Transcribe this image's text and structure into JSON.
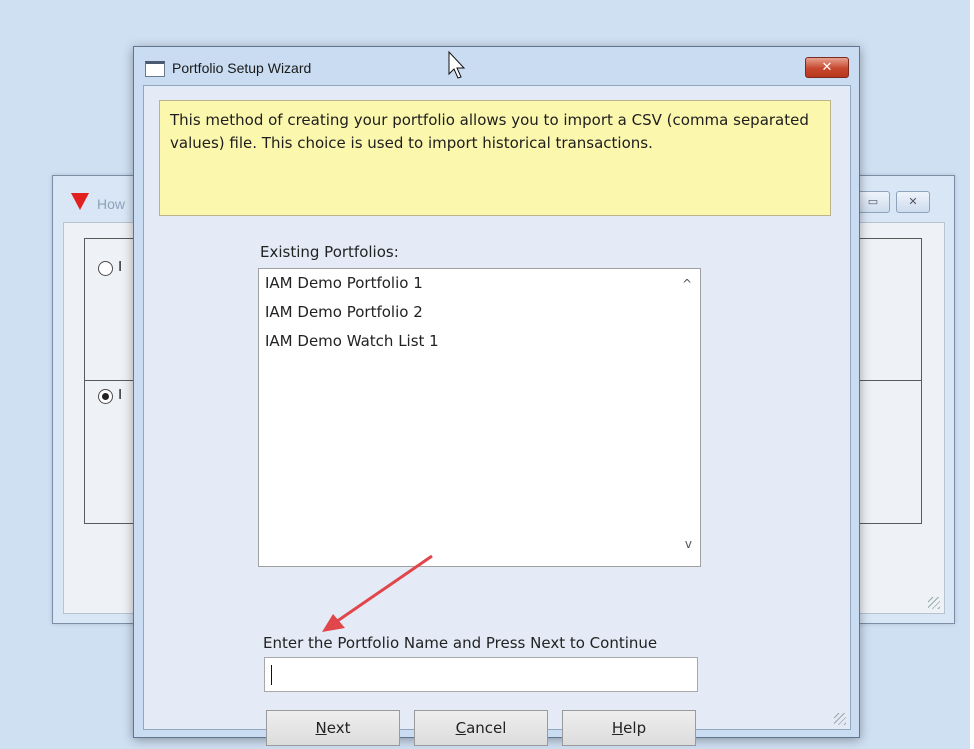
{
  "background_window": {
    "title": "How",
    "buttons": {
      "restore": "▭",
      "close": "✕"
    },
    "options": [
      {
        "letter": "I",
        "checked": false
      },
      {
        "letter": "I",
        "checked": true
      }
    ]
  },
  "dialog": {
    "title": "Portfolio Setup Wizard",
    "close_label": "✕",
    "info_text": "This method of creating your portfolio allows you to import a CSV (comma separated values) file.  This choice is used to import historical transactions.",
    "existing_label": "Existing Portfolios:",
    "portfolios": [
      "IAM Demo Portfolio 1",
      "IAM Demo Portfolio 2",
      "IAM Demo Watch List 1"
    ],
    "scroll_up": "^",
    "scroll_down": "v",
    "name_prompt": "Enter the Portfolio Name and Press Next to Continue",
    "name_value": "",
    "buttons": {
      "next": {
        "key": "N",
        "rest": "ext"
      },
      "cancel": {
        "key": "C",
        "rest": "ancel"
      },
      "help": {
        "key": "H",
        "rest": "elp"
      }
    }
  },
  "colors": {
    "annotation_arrow": "#e0464a",
    "info_background": "#fbf7ad",
    "desktop": "#cfe0f3"
  }
}
